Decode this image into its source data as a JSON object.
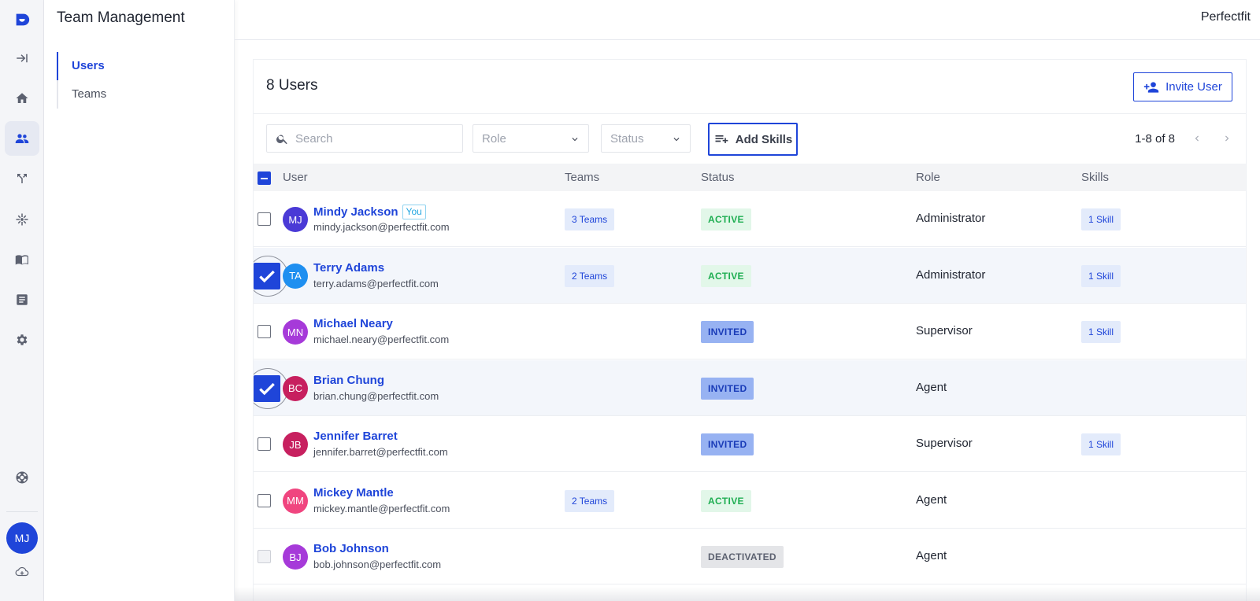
{
  "brand": "Perfectfit",
  "rail": {
    "avatar_initials": "MJ"
  },
  "subnav": {
    "title": "Team Management",
    "items": [
      {
        "label": "Users",
        "active": true
      },
      {
        "label": "Teams",
        "active": false
      }
    ]
  },
  "card": {
    "title": "8 Users",
    "invite_label": "Invite User"
  },
  "filters": {
    "search_placeholder": "Search",
    "role_label": "Role",
    "status_label": "Status",
    "add_skills_label": "Add Skills",
    "pagination": "1-8 of 8"
  },
  "table": {
    "headers": {
      "user": "User",
      "teams": "Teams",
      "status": "Status",
      "role": "Role",
      "skills": "Skills"
    },
    "rows": [
      {
        "initials": "MJ",
        "avatar_color": "#4a3ad6",
        "name": "Mindy Jackson",
        "you": "You",
        "email": "mindy.jackson@perfectfit.com",
        "teams": "3 Teams",
        "status": "ACTIVE",
        "role": "Administrator",
        "skills": "1 Skill",
        "selected": false
      },
      {
        "initials": "TA",
        "avatar_color": "#1e8ff0",
        "name": "Terry Adams",
        "email": "terry.adams@perfectfit.com",
        "teams": "2 Teams",
        "status": "ACTIVE",
        "role": "Administrator",
        "skills": "1 Skill",
        "selected": true
      },
      {
        "initials": "MN",
        "avatar_color": "#a63ad9",
        "name": "Michael Neary",
        "email": "michael.neary@perfectfit.com",
        "teams": "",
        "status": "INVITED",
        "role": "Supervisor",
        "skills": "1 Skill",
        "selected": false
      },
      {
        "initials": "BC",
        "avatar_color": "#c7205f",
        "name": "Brian Chung",
        "email": "brian.chung@perfectfit.com",
        "teams": "",
        "status": "INVITED",
        "role": "Agent",
        "skills": "",
        "selected": true
      },
      {
        "initials": "JB",
        "avatar_color": "#c7205f",
        "name": "Jennifer Barret",
        "email": "jennifer.barret@perfectfit.com",
        "teams": "",
        "status": "INVITED",
        "role": "Supervisor",
        "skills": "1 Skill",
        "selected": false
      },
      {
        "initials": "MM",
        "avatar_color": "#f0457f",
        "name": "Mickey Mantle",
        "email": "mickey.mantle@perfectfit.com",
        "teams": "2 Teams",
        "status": "ACTIVE",
        "role": "Agent",
        "skills": "",
        "selected": false
      },
      {
        "initials": "BJ",
        "avatar_color": "#a63ad9",
        "name": "Bob Johnson",
        "email": "bob.johnson@perfectfit.com",
        "teams": "",
        "status": "DEACTIVATED",
        "role": "Agent",
        "skills": "",
        "selected": false,
        "disabled": true
      }
    ]
  },
  "colors": {
    "accent": "#1f45d9",
    "status_active_bg": "#e2f7e9",
    "status_active_fg": "#1fae52",
    "status_invited_bg": "#97b2f2",
    "status_invited_fg": "#1a3cb8",
    "status_deactivated_bg": "#e4e5e8",
    "status_deactivated_fg": "#5c6170"
  }
}
